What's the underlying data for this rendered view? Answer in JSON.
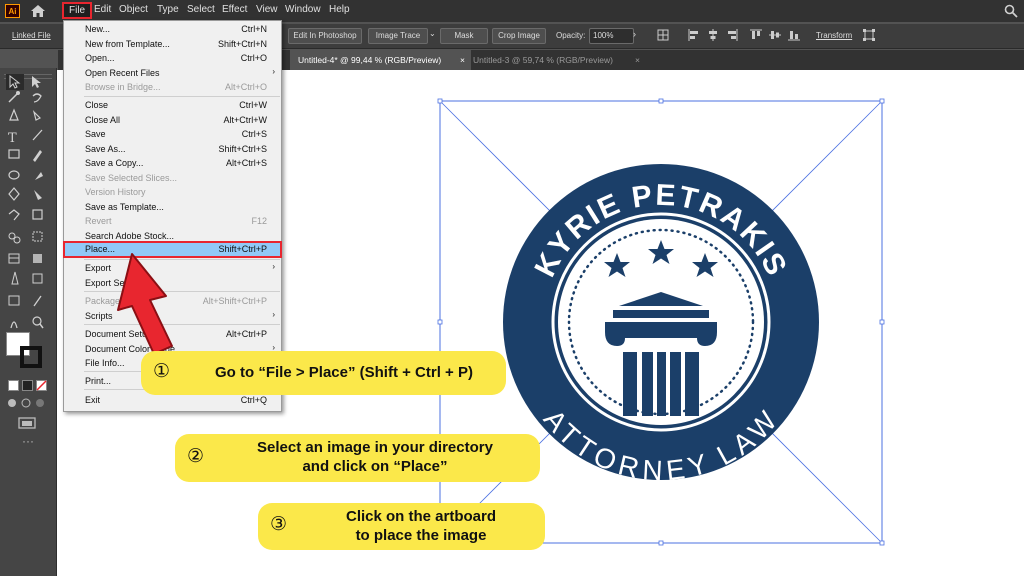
{
  "app": {
    "logo": "Ai"
  },
  "menubar": {
    "items": [
      "File",
      "Edit",
      "Object",
      "Type",
      "Select",
      "Effect",
      "View",
      "Window",
      "Help"
    ],
    "active": "File"
  },
  "controlbar": {
    "linked_file": "Linked File",
    "edit_photoshop": "Edit In Photoshop",
    "image_trace": "Image Trace",
    "mask": "Mask",
    "crop_image": "Crop Image",
    "opacity_label": "Opacity:",
    "opacity_value": "100%",
    "transform": "Transform"
  },
  "tabs": [
    {
      "label": "Untitled-4* @ 99,44 % (RGB/Preview)",
      "close": "×"
    },
    {
      "label": "Untitled-3 @ 59,74 % (RGB/Preview)",
      "close": "×"
    }
  ],
  "file_menu": {
    "items": [
      {
        "label": "New...",
        "shortcut": "Ctrl+N"
      },
      {
        "label": "New from Template...",
        "shortcut": "Shift+Ctrl+N"
      },
      {
        "label": "Open...",
        "shortcut": "Ctrl+O"
      },
      {
        "label": "Open Recent Files",
        "shortcut": "›"
      },
      {
        "label": "Browse in Bridge...",
        "shortcut": "Alt+Ctrl+O"
      },
      {
        "label": "Close",
        "shortcut": "Ctrl+W"
      },
      {
        "label": "Close All",
        "shortcut": "Alt+Ctrl+W"
      },
      {
        "label": "Save",
        "shortcut": "Ctrl+S"
      },
      {
        "label": "Save As...",
        "shortcut": "Shift+Ctrl+S"
      },
      {
        "label": "Save a Copy...",
        "shortcut": "Alt+Ctrl+S"
      },
      {
        "label": "Save Selected Slices...",
        "shortcut": ""
      },
      {
        "label": "Version History",
        "shortcut": ""
      },
      {
        "label": "Save as Template...",
        "shortcut": ""
      },
      {
        "label": "Revert",
        "shortcut": "F12"
      },
      {
        "label": "Search Adobe Stock...",
        "shortcut": ""
      },
      {
        "label": "Place...",
        "shortcut": "Shift+Ctrl+P"
      },
      {
        "label": "Export",
        "shortcut": "›"
      },
      {
        "label": "Export Selection...",
        "shortcut": ""
      },
      {
        "label": "Package...",
        "shortcut": "Alt+Shift+Ctrl+P"
      },
      {
        "label": "Scripts",
        "shortcut": "›"
      },
      {
        "label": "Document Setup...",
        "shortcut": "Alt+Ctrl+P"
      },
      {
        "label": "Document Color Mode",
        "shortcut": "›"
      },
      {
        "label": "File Info...",
        "shortcut": ""
      },
      {
        "label": "Print...",
        "shortcut": ""
      },
      {
        "label": "Exit",
        "shortcut": "Ctrl+Q"
      }
    ]
  },
  "logo": {
    "top_text": "KYRIE PETRAKIS",
    "bottom_text": "ATTORNEY LAW",
    "color_dark": "#1b3f69"
  },
  "callouts": [
    {
      "num": "①",
      "text": "Go to “File > Place” (Shift + Ctrl + P)"
    },
    {
      "num": "②",
      "text_line1": "Select an image in your directory",
      "text_line2": "and click on “Place”"
    },
    {
      "num": "③",
      "text_line1": "Click on the artboard",
      "text_line2": "to place the image"
    }
  ],
  "colors": {
    "highlight_red": "#e8262f",
    "callout_yellow": "#fbe84a",
    "menu_highlight": "#91c9f7"
  }
}
